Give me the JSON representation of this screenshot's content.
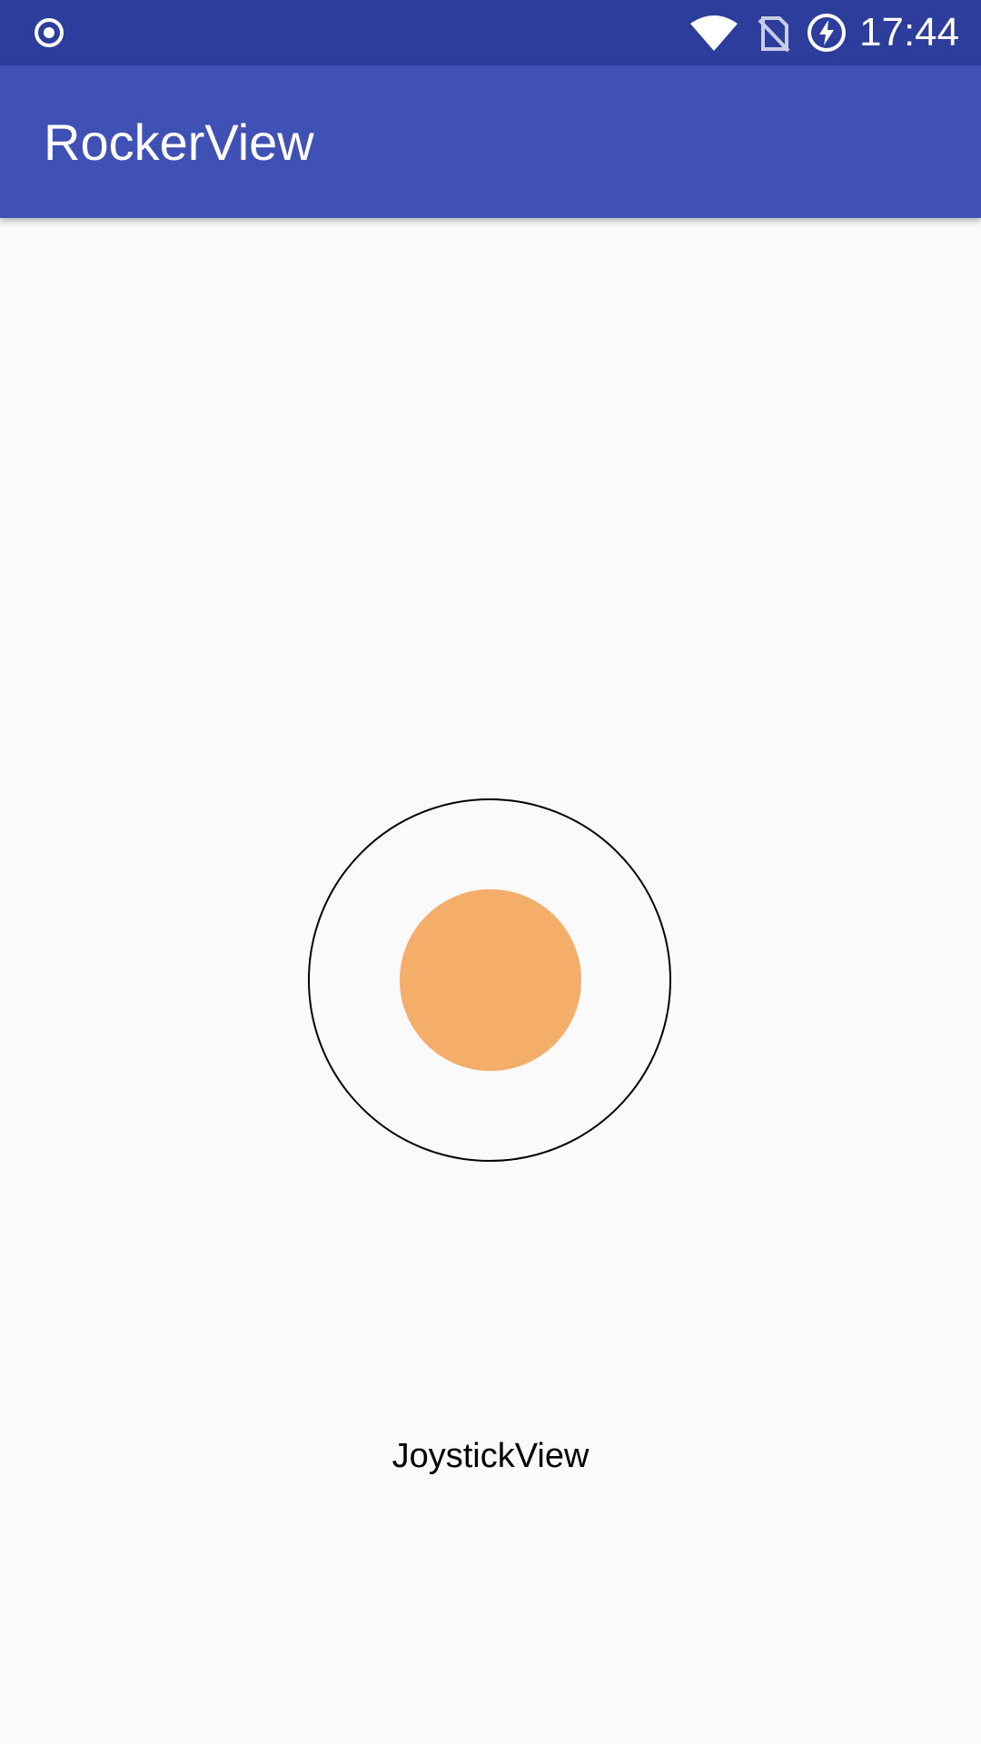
{
  "status_bar": {
    "time": "17:44",
    "icons": [
      "notification-dot-icon",
      "wifi-icon",
      "no-sim-icon",
      "battery-charging-icon"
    ]
  },
  "app_bar": {
    "title": "RockerView"
  },
  "joystick": {
    "ring_color": "#000000",
    "knob_color": "#f5ad6a"
  },
  "main": {
    "label": "JoystickView"
  },
  "colors": {
    "status_bar": "#2c3d9b",
    "app_bar": "#3f51b5",
    "background": "#fafafa"
  }
}
